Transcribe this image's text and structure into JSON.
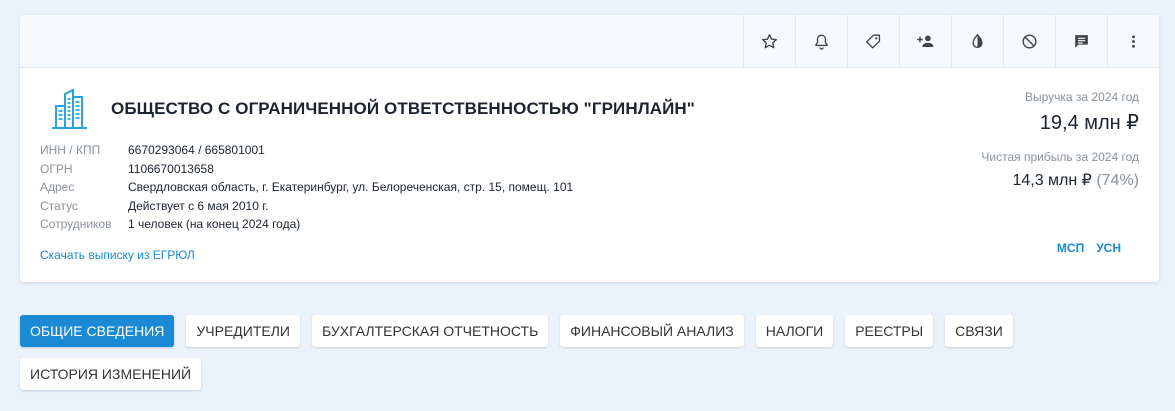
{
  "toolbar": {
    "buttons": [
      {
        "icon": "star-icon"
      },
      {
        "icon": "bell-icon"
      },
      {
        "icon": "tag-icon"
      },
      {
        "icon": "add-person-icon"
      },
      {
        "icon": "contrast-icon"
      },
      {
        "icon": "block-icon"
      },
      {
        "icon": "comment-icon"
      },
      {
        "icon": "more-vert-icon"
      }
    ]
  },
  "company": {
    "name": "ОБЩЕСТВО С ОГРАНИЧЕННОЙ ОТВЕТСТВЕННОСТЬЮ \"ГРИНЛАЙН\"",
    "logo_icon": "buildings-icon",
    "details": [
      {
        "label": "ИНН / КПП",
        "value": "6670293064 / 665801001"
      },
      {
        "label": "ОГРН",
        "value": "1106670013658"
      },
      {
        "label": "Адрес",
        "value": "Свердловская область, г. Екатеринбург, ул. Белореченская, стр. 15, помещ. 101"
      },
      {
        "label": "Статус",
        "value": "Действует с 6 мая 2010 г."
      },
      {
        "label": "Сотрудников",
        "value": "1 человек (на конец 2024 года)"
      }
    ],
    "download_link": "Скачать выписку из ЕГРЮЛ"
  },
  "finance": {
    "revenue_label": "Выручка за 2024 год",
    "revenue_value": "19,4 млн ₽",
    "profit_label": "Чистая прибыль за 2024 год",
    "profit_value": "14,3 млн ₽",
    "profit_percent": "(74%)"
  },
  "badges": [
    "МСП",
    "УСН"
  ],
  "tabs": [
    {
      "label": "ОБЩИЕ СВЕДЕНИЯ",
      "active": true
    },
    {
      "label": "УЧРЕДИТЕЛИ"
    },
    {
      "label": "БУХГАЛТЕРСКАЯ ОТЧЕТНОСТЬ"
    },
    {
      "label": "ФИНАНСОВЫЙ АНАЛИЗ"
    },
    {
      "label": "НАЛОГИ"
    },
    {
      "label": "РЕЕСТРЫ"
    },
    {
      "label": "СВЯЗИ"
    },
    {
      "label": "ИСТОРИЯ ИЗМЕНЕНИЙ"
    }
  ],
  "colors": {
    "accent": "#1a8ad4",
    "background": "#eaf3fb",
    "logo": "#29a3df"
  }
}
